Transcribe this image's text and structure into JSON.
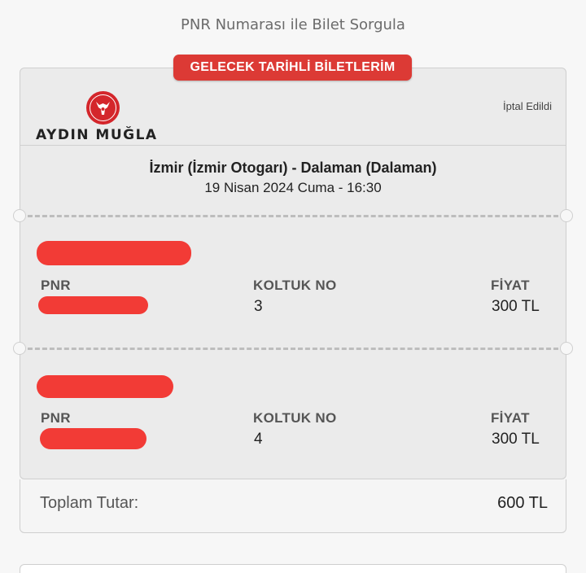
{
  "page": {
    "pnr_link": "PNR Numarası ile Bilet Sorgula"
  },
  "ticket": {
    "badge": "GELECEK TARİHLİ BİLETLERİM",
    "company": "AYDIN MUĞLA",
    "status": "İptal Edildi",
    "route": "İzmir (İzmir Otogarı) - Dalaman (Dalaman)",
    "date": "19 Nisan 2024 Cuma - 16:30",
    "labels": {
      "pnr": "PNR",
      "seat": "KOLTUK NO",
      "price": "FİYAT"
    },
    "passengers": [
      {
        "seat": "3",
        "price": "300 TL"
      },
      {
        "seat": "4",
        "price": "300 TL"
      }
    ]
  },
  "total": {
    "label": "Toplam Tutar:",
    "value": "600 TL"
  },
  "colors": {
    "accent": "#dc3a35",
    "redaction": "#f23b36"
  }
}
